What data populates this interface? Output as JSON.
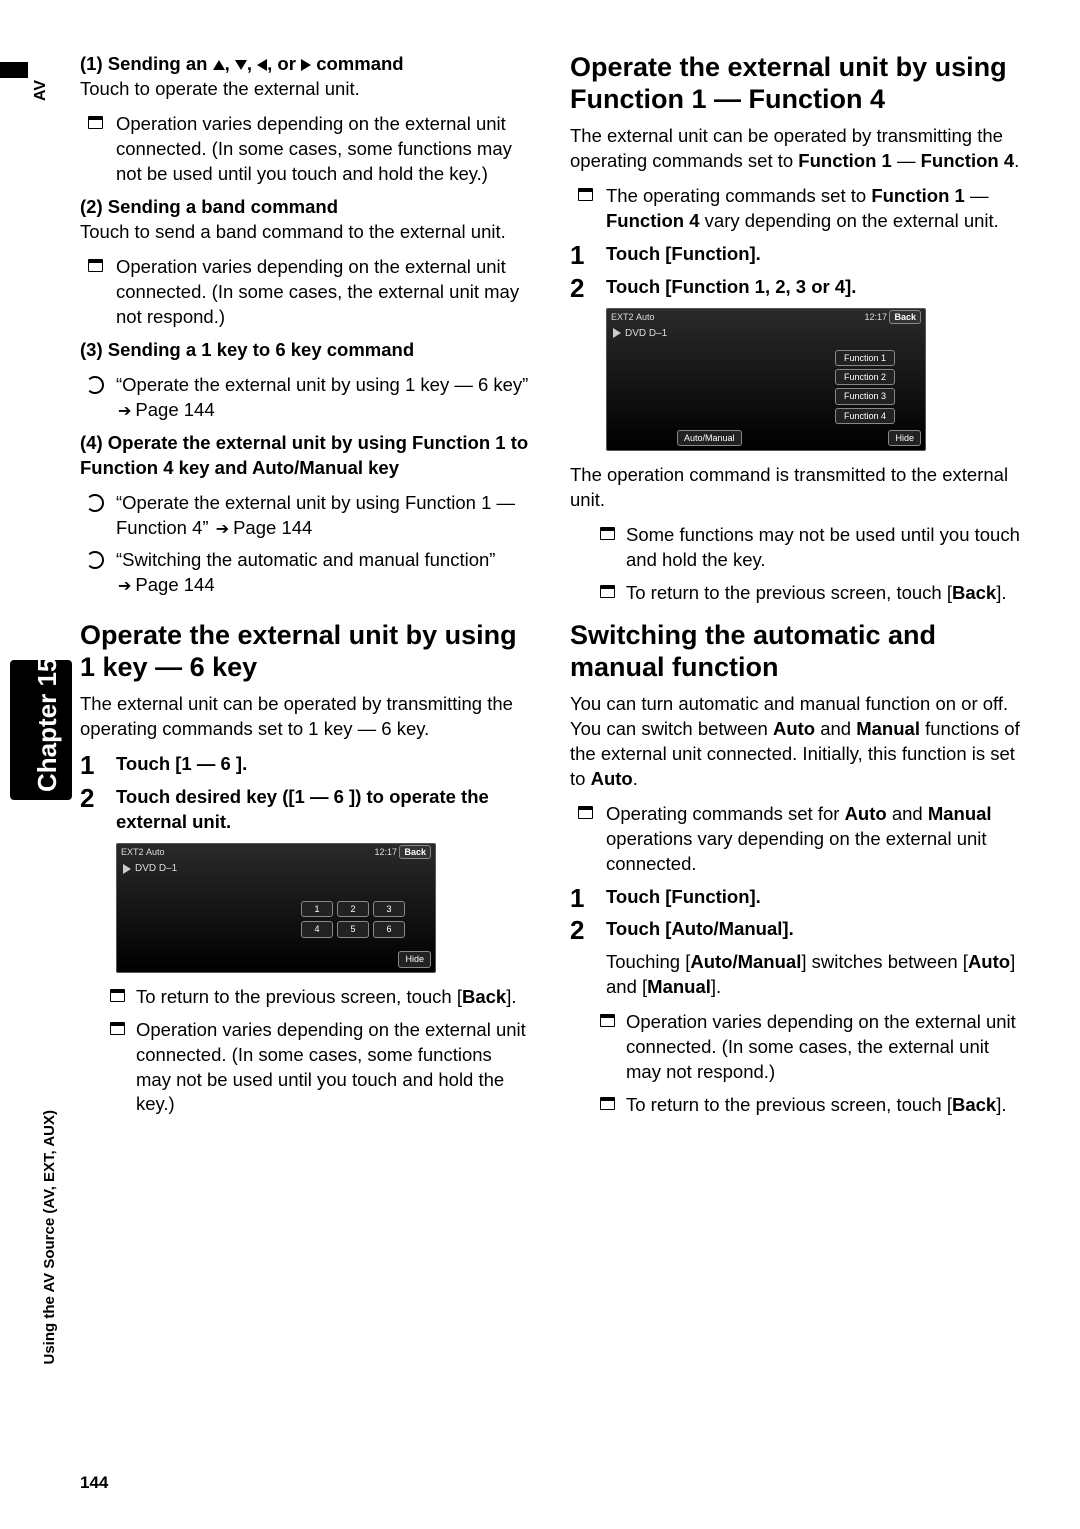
{
  "side": {
    "av": "AV",
    "chapter": "Chapter 15",
    "section": "Using the AV Source (AV, EXT, AUX)"
  },
  "pagenum": "144",
  "left": {
    "h1_pre": "(1) Sending an ",
    "h1_post": " command",
    "p1": "Touch to operate the external unit.",
    "b1": "Operation varies depending on the external unit connected. (In some cases, some functions may not be used until you touch and hold the key.)",
    "h2": "(2) Sending a band command",
    "p2": "Touch to send a band command to the external unit.",
    "b2": "Operation varies depending on the external unit connected. (In some cases, the external unit may not respond.)",
    "h3": "(3) Sending a 1 key to 6 key command",
    "b3a": "“Operate the external unit by using 1 key — 6 key” ",
    "b3b": "Page 144",
    "h4": "(4) Operate the external unit by using Function 1 to Function 4 key and Auto/Manual key",
    "b4a": "“Operate the external unit by using Function 1 — Function 4” ",
    "b4b": "Page 144",
    "b5a": "“Switching the automatic and manual function” ",
    "b5b": "Page 144",
    "sect1": "Operate the external unit by using 1 key — 6 key",
    "sect1p": "The external unit can be operated by transmitting the operating commands set to 1 key — 6 key.",
    "step1": "Touch [1 — 6 ].",
    "step2": "Touch desired key ([1 — 6 ]) to operate the external unit.",
    "ss": {
      "src": "EXT2",
      "mode": "Auto",
      "time": "12:17",
      "back": "Back",
      "title": "DVD D–1",
      "keys": [
        "1",
        "2",
        "3",
        "4",
        "5",
        "6"
      ],
      "hide": "Hide"
    },
    "after1a": "To return to the previous screen, touch [",
    "after1b": "Back",
    "after1c": "].",
    "after2": "Operation varies depending on the external unit connected. (In some cases, some functions may not be used until you touch and hold the key.)"
  },
  "right": {
    "sect2": "Operate the external unit by using Function 1 — Function 4",
    "p1a": "The external unit can be operated by transmitting the operating commands set to ",
    "p1b": "Function 1",
    "p1c": " — ",
    "p1d": "Function 4",
    "p1e": ".",
    "b1a": "The operating commands set to ",
    "b1b": "Function 1",
    "b1c": " — ",
    "b1d": "Function 4",
    "b1e": " vary depending on the external unit.",
    "step1": "Touch [Function].",
    "step2": "Touch [Function 1, 2, 3 or 4].",
    "ss": {
      "src": "EXT2",
      "mode": "Auto",
      "time": "12:17",
      "back": "Back",
      "title": "DVD D–1",
      "funcs": [
        "Function 1",
        "Function 2",
        "Function 3",
        "Function 4"
      ],
      "automanual": "Auto/Manual",
      "hide": "Hide"
    },
    "p2": "The operation command is transmitted to the external unit.",
    "b2": "Some functions may not be used until you touch and hold the key.",
    "b3a": "To return to the previous screen, touch [",
    "b3b": "Back",
    "b3c": "].",
    "sect3": "Switching the automatic and manual function",
    "p3a": "You can turn automatic and manual function on or off. You can switch between ",
    "p3b": "Auto",
    "p3c": " and ",
    "p3d": "Manual",
    "p3e": " functions of the external unit connected. Initially, this function is set to  ",
    "p3f": "Auto",
    "p3g": ".",
    "b4a": "Operating commands set for ",
    "b4b": "Auto",
    "b4c": " and ",
    "b4d": "Manual",
    "b4e": " operations vary depending on the external unit connected.",
    "step3": "Touch [Function].",
    "step4": "Touch [Auto/Manual].",
    "p4a": "Touching [",
    "p4b": "Auto/Manual",
    "p4c": "] switches between [",
    "p4d": "Auto",
    "p4e": "] and [",
    "p4f": "Manual",
    "p4g": "].",
    "b5": "Operation varies depending on the external unit connected. (In some cases, the external unit may not respond.)",
    "b6a": "To return to the previous screen, touch [",
    "b6b": "Back",
    "b6c": "]."
  }
}
